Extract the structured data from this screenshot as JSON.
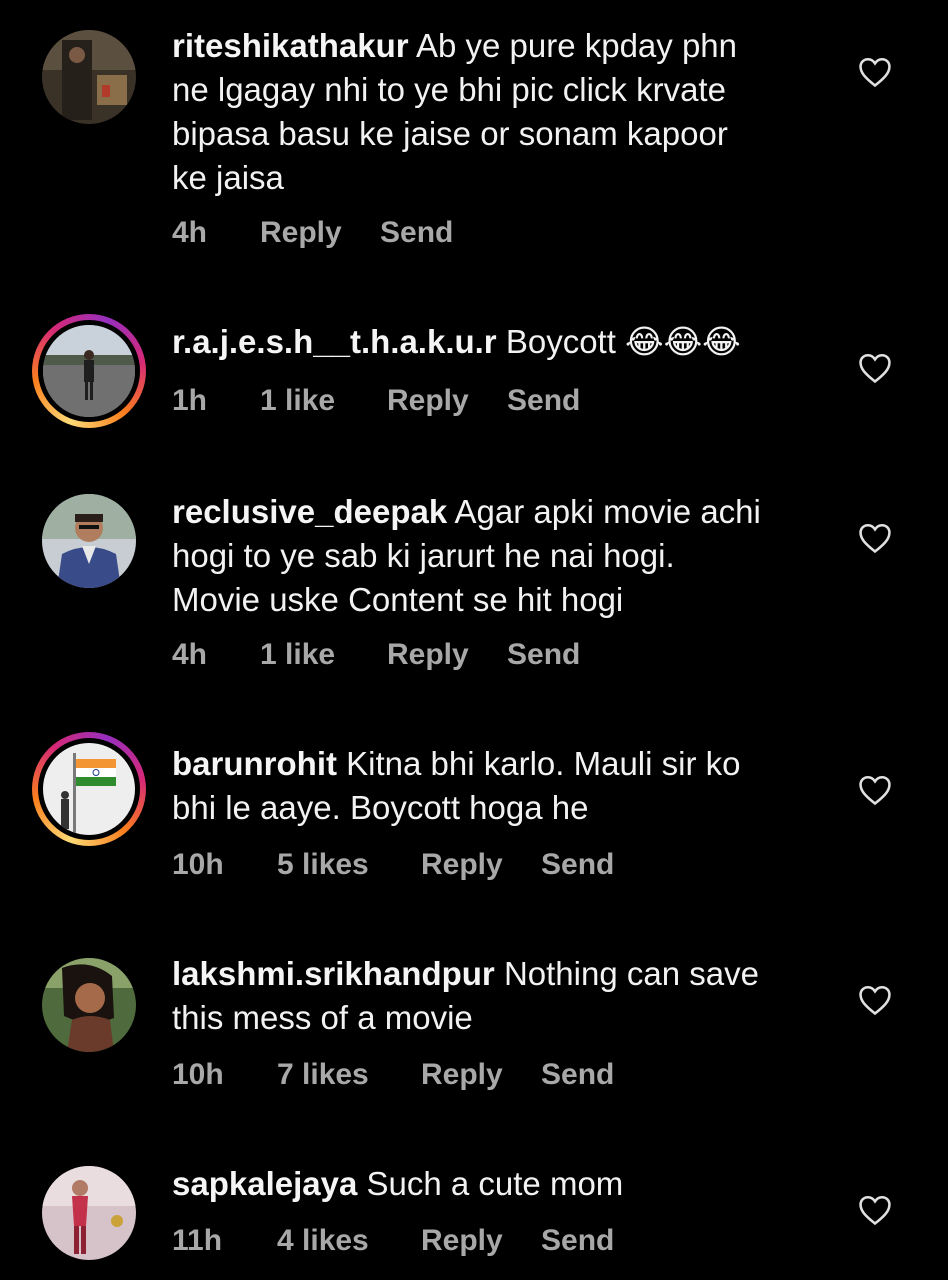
{
  "colors": {
    "background": "#000000",
    "text": "#f2f2f2",
    "meta": "#a8a8a8",
    "story_ring": [
      "#feda75",
      "#fa7e1e",
      "#d62976",
      "#962fbf"
    ]
  },
  "comments": [
    {
      "username": "riteshikathakur",
      "text": "Ab ye pure kpday phn ne lgagay nhi to ye bhi pic click krvate bipasa basu ke jaise or sonam kapoor ke jaisa",
      "lines": [
        "Ab ye pure kpday phn",
        "ne lgagay nhi to ye bhi pic click krvate",
        "bipasa basu ke jaise or sonam kapoor",
        "ke jaisa"
      ],
      "time": "4h",
      "likes": "",
      "reply_label": "Reply",
      "send_label": "Send",
      "has_story_ring": false,
      "like_icon": "heart-outline-icon"
    },
    {
      "username": "r.a.j.e.s.h__t.h.a.k.u.r",
      "text": "Boycott 😂😂😂",
      "lines": [
        "Boycott 😂😂😂"
      ],
      "time": "1h",
      "likes": "1 like",
      "reply_label": "Reply",
      "send_label": "Send",
      "has_story_ring": true,
      "like_icon": "heart-outline-icon"
    },
    {
      "username": "reclusive_deepak",
      "text": "Agar apki movie achi hogi to ye sab ki jarurt he nai hogi. Movie uske Content se hit hogi",
      "lines": [
        "Agar apki movie achi",
        "hogi to ye sab ki jarurt he nai hogi.",
        "Movie uske Content se hit hogi"
      ],
      "time": "4h",
      "likes": "1 like",
      "reply_label": "Reply",
      "send_label": "Send",
      "has_story_ring": false,
      "like_icon": "heart-outline-icon"
    },
    {
      "username": "barunrohit",
      "text": "Kitna bhi karlo. Mauli sir ko bhi le aaye. Boycott hoga he",
      "lines": [
        "Kitna bhi karlo. Mauli sir ko",
        "bhi le aaye. Boycott hoga he"
      ],
      "time": "10h",
      "likes": "5 likes",
      "reply_label": "Reply",
      "send_label": "Send",
      "has_story_ring": true,
      "like_icon": "heart-outline-icon"
    },
    {
      "username": "lakshmi.srikhandpur",
      "text": "Nothing can save this mess of a movie",
      "lines": [
        "Nothing can save",
        "this mess of a movie"
      ],
      "time": "10h",
      "likes": "7 likes",
      "reply_label": "Reply",
      "send_label": "Send",
      "has_story_ring": false,
      "like_icon": "heart-outline-icon"
    },
    {
      "username": "sapkalejaya",
      "text": "Such a cute mom",
      "lines": [
        "Such a cute mom"
      ],
      "time": "11h",
      "likes": "4 likes",
      "reply_label": "Reply",
      "send_label": "Send",
      "has_story_ring": false,
      "like_icon": "heart-outline-icon"
    }
  ]
}
